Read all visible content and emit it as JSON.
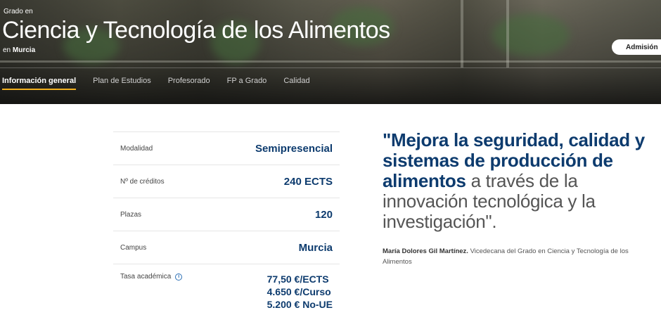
{
  "hero": {
    "pre_title": "Grado en",
    "title": "Ciencia y Tecnología de los Alimentos",
    "location_prefix": "en",
    "location": "Murcia",
    "admission_label": "Admisión"
  },
  "tabs": [
    {
      "label": "Información general",
      "active": true
    },
    {
      "label": "Plan de Estudios",
      "active": false
    },
    {
      "label": "Profesorado",
      "active": false
    },
    {
      "label": "FP a Grado",
      "active": false
    },
    {
      "label": "Calidad",
      "active": false
    }
  ],
  "info": {
    "rows": [
      {
        "label": "Modalidad",
        "value": "Semipresencial"
      },
      {
        "label": "Nº de créditos",
        "value": "240 ECTS"
      },
      {
        "label": "Plazas",
        "value": "120"
      },
      {
        "label": "Campus",
        "value": "Murcia"
      }
    ],
    "fee": {
      "label": "Tasa académica",
      "values": [
        "77,50 €/ECTS",
        "4.650 €/Curso",
        "5.200 € No-UE"
      ]
    },
    "info_icon": "info-icon"
  },
  "quote": {
    "strong": "\"Mejora la seguridad, calidad y sistemas de producción de alimentos",
    "soft": " a través de la innovación tecnológica y la investigación\"."
  },
  "author": {
    "name": "María Dolores Gil Martínez.",
    "role": " Vicedecana del Grado en Ciencia y Tecnología de los Alimentos"
  },
  "colors": {
    "accent_blue": "#0d3b6e",
    "tab_underline": "#f2b01e"
  }
}
